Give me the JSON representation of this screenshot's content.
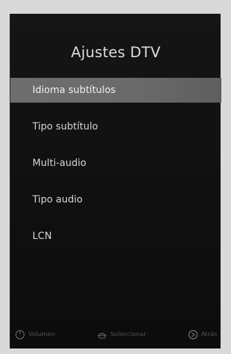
{
  "screen": {
    "title": "Ajustes DTV"
  },
  "menu": {
    "items": [
      {
        "label": "Idioma subtítulos",
        "selected": true
      },
      {
        "label": "Tipo subtítulo",
        "selected": false
      },
      {
        "label": "Multi-audio",
        "selected": false
      },
      {
        "label": "Tipo audio",
        "selected": false
      },
      {
        "label": "LCN",
        "selected": false
      }
    ]
  },
  "footer": {
    "hints": [
      {
        "icon": "power-icon",
        "label": "Volumen"
      },
      {
        "icon": "remote-icon",
        "label": "Seleccionar"
      },
      {
        "icon": "back-icon",
        "label": "Atrás"
      }
    ]
  },
  "colors": {
    "background": "#111111",
    "highlight": "#6e6e6e",
    "text": "#d6d6d6"
  }
}
